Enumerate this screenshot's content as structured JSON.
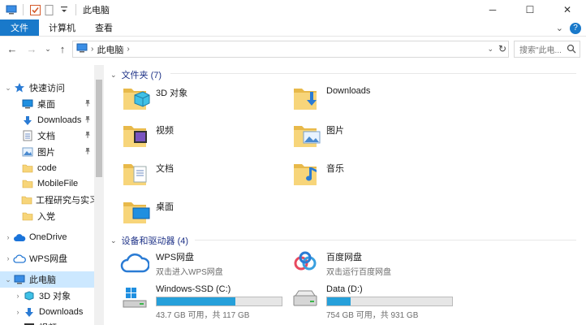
{
  "title_bar": {
    "title": "此电脑",
    "minimize": "─",
    "maximize": "☐",
    "close": "✕"
  },
  "ribbon": {
    "tabs": [
      "文件",
      "计算机",
      "查看"
    ],
    "collapse_glyph": "⌄",
    "help_glyph": "?"
  },
  "address": {
    "crumb": "此电脑",
    "back": "←",
    "forward": "→",
    "recent": "⌄",
    "up": "↑",
    "search_placeholder": "搜索\"此电..."
  },
  "nav": {
    "items": [
      {
        "label": "快速访问",
        "icon": "star-icon",
        "arrow": "⌄",
        "pinned": false
      },
      {
        "label": "桌面",
        "icon": "desktop-icon",
        "arrow": "",
        "pinned": true
      },
      {
        "label": "Downloads",
        "icon": "download-icon",
        "arrow": "",
        "pinned": true
      },
      {
        "label": "文档",
        "icon": "document-icon",
        "arrow": "",
        "pinned": true
      },
      {
        "label": "图片",
        "icon": "picture-icon",
        "arrow": "",
        "pinned": true
      },
      {
        "label": "code",
        "icon": "folder-icon",
        "arrow": "",
        "pinned": false
      },
      {
        "label": "MobileFile",
        "icon": "folder-icon",
        "arrow": "",
        "pinned": false
      },
      {
        "label": "工程研究与实习",
        "icon": "folder-icon",
        "arrow": "",
        "pinned": false
      },
      {
        "label": "入党",
        "icon": "folder-icon",
        "arrow": "",
        "pinned": false
      },
      {
        "label": "OneDrive",
        "icon": "cloud-icon",
        "arrow": "›",
        "pinned": false
      },
      {
        "label": "WPS网盘",
        "icon": "wps-cloud-icon",
        "arrow": "›",
        "pinned": false
      },
      {
        "label": "此电脑",
        "icon": "computer-icon",
        "arrow": "⌄",
        "pinned": false
      },
      {
        "label": "3D 对象",
        "icon": "3d-objects-icon",
        "arrow": "›",
        "pinned": false
      },
      {
        "label": "Downloads",
        "icon": "download-icon",
        "arrow": "›",
        "pinned": false
      },
      {
        "label": "视频",
        "icon": "video-icon",
        "arrow": "›",
        "pinned": false
      }
    ],
    "pin_glyph": "📌"
  },
  "folders_section": {
    "header": "文件夹 (7)",
    "items": [
      {
        "label": "3D 对象",
        "icon": "3d-objects-folder-icon"
      },
      {
        "label": "Downloads",
        "icon": "downloads-folder-icon"
      },
      {
        "label": "视频",
        "icon": "video-folder-icon"
      },
      {
        "label": "图片",
        "icon": "pictures-folder-icon"
      },
      {
        "label": "文档",
        "icon": "documents-folder-icon"
      },
      {
        "label": "音乐",
        "icon": "music-folder-icon"
      },
      {
        "label": "桌面",
        "icon": "desktop-folder-icon"
      }
    ]
  },
  "devices_section": {
    "header": "设备和驱动器 (4)",
    "items": [
      {
        "name": "WPS网盘",
        "sub": "双击进入WPS网盘",
        "icon": "wps-cloud-icon"
      },
      {
        "name": "百度网盘",
        "sub": "双击运行百度网盘",
        "icon": "baidu-netdisk-icon"
      },
      {
        "name": "Windows-SSD (C:)",
        "sub": "43.7 GB 可用，共 117 GB",
        "icon": "windows-drive-icon",
        "used_fraction": 0.63
      },
      {
        "name": "Data (D:)",
        "sub": "754 GB 可用，共 931 GB",
        "icon": "hard-drive-icon",
        "used_fraction": 0.19
      }
    ]
  },
  "colors": {
    "accent": "#1979ca",
    "selected": "#cce8ff",
    "section_header": "#1e3287",
    "bar_fill": "#26a0da",
    "folder": "#f7d57a"
  }
}
